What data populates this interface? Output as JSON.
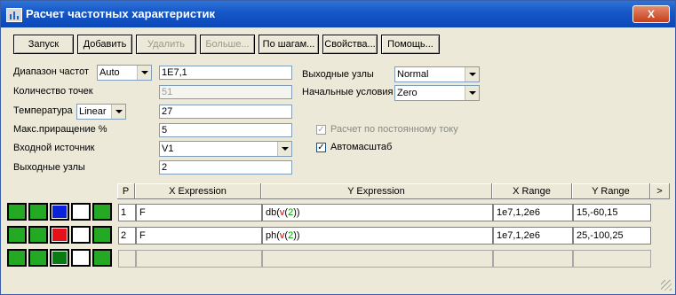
{
  "window": {
    "title": "Расчет частотных характеристик",
    "close_label": "X"
  },
  "toolbar": {
    "run": "Запуск",
    "add": "Добавить",
    "delete": "Удалить",
    "more": "Больше...",
    "step": "По шагам...",
    "properties": "Свойства...",
    "help": "Помощь..."
  },
  "form": {
    "freq_range": {
      "label": "Диапазон частот",
      "mode": "Auto",
      "value": "1E7,1"
    },
    "points": {
      "label": "Количество точек",
      "value": "51"
    },
    "temperature": {
      "label": "Температура",
      "mode": "Linear",
      "value": "27"
    },
    "max_step": {
      "label": "Макс.приращение %",
      "value": "5"
    },
    "input_source": {
      "label": "Входной источник",
      "value": "V1"
    },
    "output_nodes_left": {
      "label": "Выходные узлы",
      "value": "2"
    },
    "output_nodes_right": {
      "label": "Выходные узлы",
      "value": "Normal"
    },
    "initial_conditions": {
      "label": "Начальные условия",
      "value": "Zero"
    },
    "dc_calc": {
      "label": "Расчет по постоянному току",
      "checked": true
    },
    "autoscale": {
      "label": "Автомасштаб",
      "checked": true
    }
  },
  "grid": {
    "headers": {
      "p": "P",
      "x": "X Expression",
      "y": "Y Expression",
      "xr": "X Range",
      "yr": "Y Range",
      "more": ">"
    },
    "rows": [
      {
        "p": "1",
        "x": "F",
        "y_func": "db(",
        "y_var": "v",
        "y_lp": "(",
        "y_num": "2",
        "y_rp": ")",
        "y_close": ")",
        "xr": "1e7,1,2e6",
        "yr": "15,-60,15",
        "color": "#0a23d9"
      },
      {
        "p": "2",
        "x": "F",
        "y_func": "ph(",
        "y_var": "v",
        "y_lp": "(",
        "y_num": "2",
        "y_rp": ")",
        "y_close": ")",
        "xr": "1e7,1,2e6",
        "yr": "25,-100,25",
        "color": "#e4101a"
      },
      {
        "p": "",
        "x": "",
        "xr": "",
        "yr": "",
        "color": "#0a7a14"
      }
    ]
  },
  "icons": {
    "title": "chart-window-icon",
    "tool1": "vertical-grid-icon",
    "tool2": "horizontal-grid-icon",
    "tool4": "table-grid-icon",
    "tool5": "curve-icon"
  }
}
